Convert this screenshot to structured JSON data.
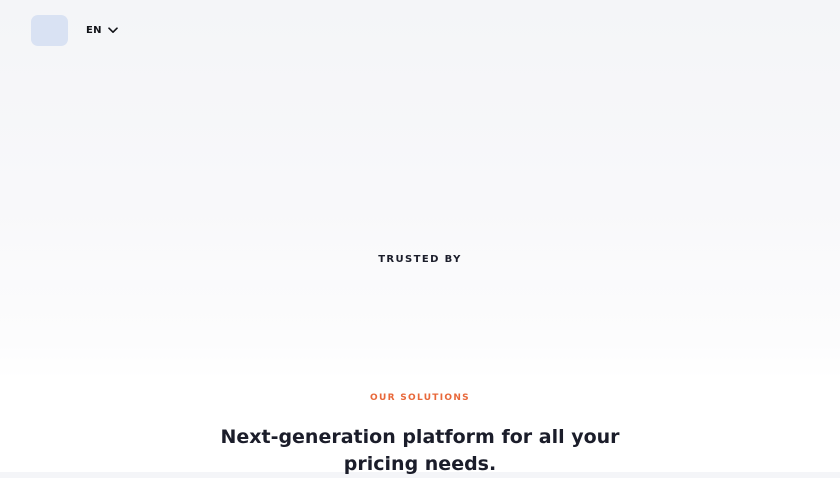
{
  "header": {
    "language": {
      "label": "EN",
      "icon": "chevron-down-icon"
    }
  },
  "trusted_by": {
    "label": "TRUSTED BY"
  },
  "solutions": {
    "eyebrow": "OUR SOLUTIONS",
    "heading": "Next-generation platform for all your pricing needs."
  },
  "colors": {
    "accent": "#e8683a",
    "text_dark": "#1b1d2a",
    "logo_placeholder": "#d9e2f3"
  }
}
